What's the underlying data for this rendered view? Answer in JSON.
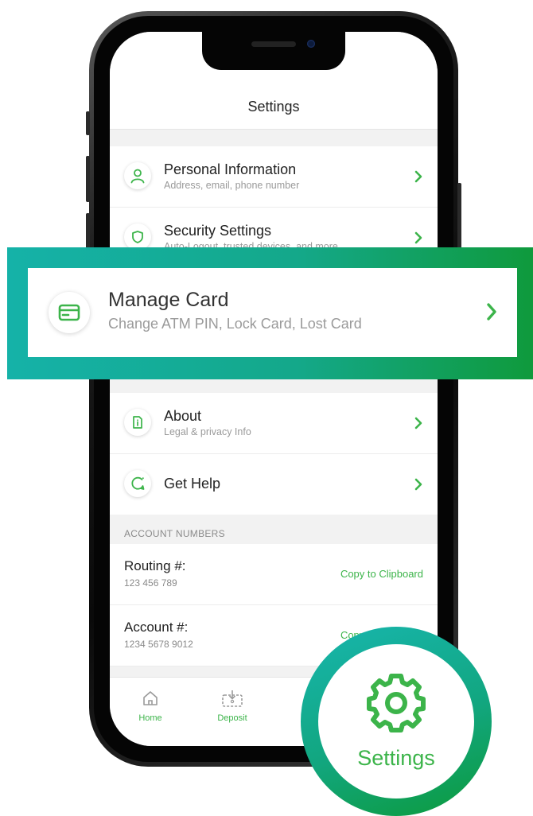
{
  "screen": {
    "title": "Settings",
    "menu_items": [
      {
        "title": "Personal Information",
        "subtitle": "Address, email, phone number",
        "icon": "person-icon"
      },
      {
        "title": "Security Settings",
        "subtitle": "Auto-Logout, trusted devices, and more",
        "icon": "shield-icon"
      },
      {
        "title": "About",
        "subtitle": "Legal & privacy Info",
        "icon": "document-info-icon"
      },
      {
        "title": "Get Help",
        "subtitle": "",
        "icon": "chat-bubble-icon"
      }
    ],
    "account_section": {
      "header": "ACCOUNT NUMBERS",
      "rows": [
        {
          "label": "Routing #:",
          "value": "123 456 789",
          "action": "Copy to Clipboard"
        },
        {
          "label": "Account #:",
          "value": "1234 5678 9012",
          "action": "Copy to Clipboard"
        }
      ]
    },
    "tabs": [
      {
        "label": "Home",
        "icon": "home-icon"
      },
      {
        "label": "Deposit",
        "icon": "deposit-icon"
      }
    ]
  },
  "callout": {
    "title": "Manage Card",
    "subtitle": "Change ATM PIN, Lock Card, Lost Card",
    "icon": "credit-card-icon"
  },
  "badge": {
    "label": "Settings",
    "icon": "gear-icon"
  },
  "colors": {
    "accent_green": "#3cb44a",
    "callout_gradient_start": "#15b2a8",
    "callout_gradient_end": "#0f9a3c"
  }
}
